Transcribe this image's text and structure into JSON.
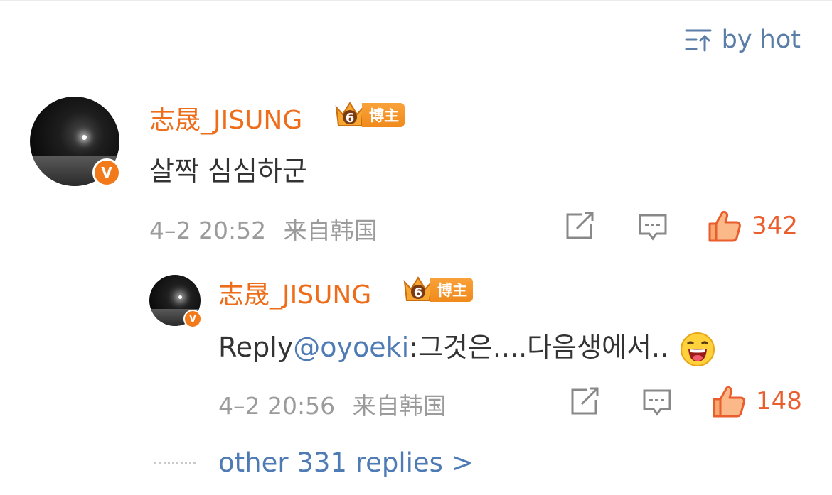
{
  "sort": {
    "label": "by hot"
  },
  "comment": {
    "username": "志晟_JISUNG",
    "badge_level": "6",
    "badge_tag": "博主",
    "verified_mark": "V",
    "text": "살짝 심심하군",
    "time": "4–2 20:52",
    "source": "来自韩国",
    "likes": "342"
  },
  "reply": {
    "username": "志晟_JISUNG",
    "badge_level": "6",
    "badge_tag": "博主",
    "verified_mark": "V",
    "prefix": "Reply",
    "mention": "@oyoeki",
    "text": ":그것은....다음생에서..",
    "time": "4–2 20:56",
    "source": "来自韩国",
    "likes": "148"
  },
  "more_replies": "other 331 replies >",
  "colors": {
    "accent": "#ee6d1a",
    "link": "#4f7bb5",
    "like": "#ea5d2c",
    "meta": "#9b9b9b"
  },
  "icons": [
    "sort-icon",
    "repost-icon",
    "comment-icon",
    "like-icon",
    "laugh-emoji-icon",
    "crown-badge-icon",
    "verified-badge-icon"
  ]
}
